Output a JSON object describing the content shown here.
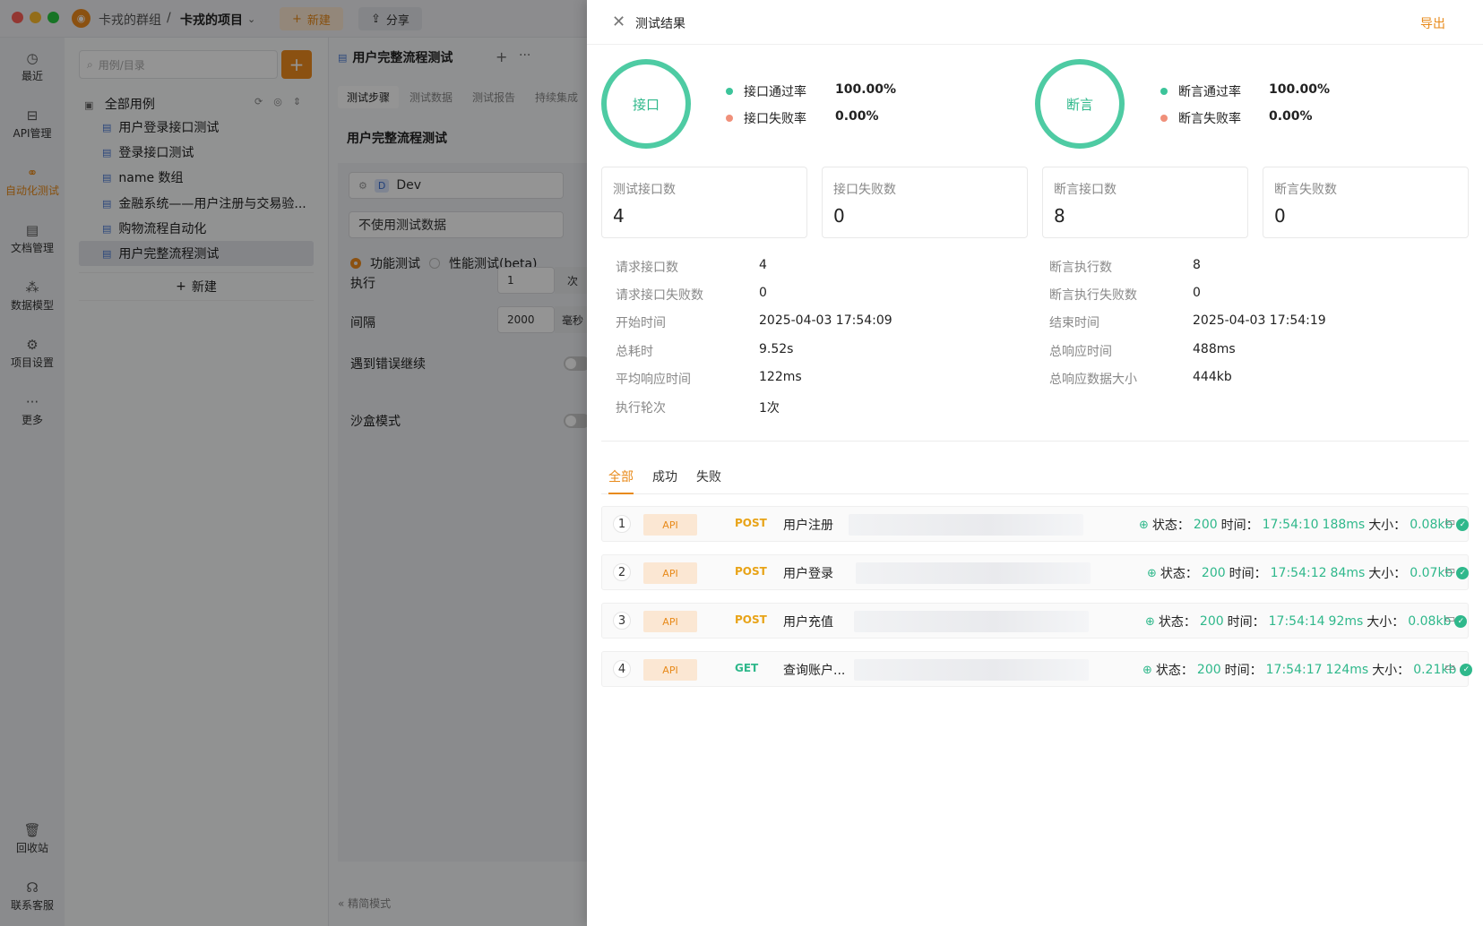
{
  "titlebar": {
    "group": "卡戎的群组",
    "separator": "/",
    "project": "卡戎的项目",
    "new_label": "新建",
    "share_label": "分享"
  },
  "leftnav": {
    "items": [
      {
        "label": "最近",
        "icon": "clock-icon"
      },
      {
        "label": "API管理",
        "icon": "api-icon"
      },
      {
        "label": "自动化测试",
        "icon": "automation-icon"
      },
      {
        "label": "文档管理",
        "icon": "document-icon"
      },
      {
        "label": "数据模型",
        "icon": "data-model-icon"
      },
      {
        "label": "项目设置",
        "icon": "settings-icon"
      },
      {
        "label": "更多",
        "icon": "more-icon"
      },
      {
        "label": "回收站",
        "icon": "trash-icon"
      },
      {
        "label": "联系客服",
        "icon": "headset-icon"
      }
    ]
  },
  "tree": {
    "search_placeholder": "用例/目录",
    "root": "全部用例",
    "items": [
      "用户登录接口测试",
      "登录接口测试",
      "name 数组",
      "金融系统——用户注册与交易验...",
      "购物流程自动化",
      "用户完整流程测试"
    ],
    "new_label": "新建"
  },
  "mid": {
    "tab": "用户完整流程测试",
    "subtabs": [
      "测试步骤",
      "测试数据",
      "测试报告",
      "持续集成"
    ],
    "title": "用户完整流程测试",
    "env": "Dev",
    "env_badge": "D",
    "data_select": "不使用测试数据",
    "radio_functional": "功能测试",
    "radio_perf": "性能测试(beta)",
    "exec_label": "执行",
    "exec_value": "1",
    "exec_unit": "次",
    "interval_label": "间隔",
    "interval_value": "2000",
    "interval_unit": "毫秒",
    "continue_label": "遇到错误继续",
    "sandbox_label": "沙盒模式",
    "simple_mode": "精简模式"
  },
  "drawer": {
    "title": "测试结果",
    "export": "导出",
    "ring_api": "接口",
    "ring_assert": "断言",
    "api_pass_label": "接口通过率",
    "api_pass_value": "100.00%",
    "api_fail_label": "接口失败率",
    "api_fail_value": "0.00%",
    "assert_pass_label": "断言通过率",
    "assert_pass_value": "100.00%",
    "assert_fail_label": "断言失败率",
    "assert_fail_value": "0.00%",
    "pass_color": "#3cc49a",
    "fail_color": "#f0907a",
    "cards": [
      {
        "label": "测试接口数",
        "value": "4"
      },
      {
        "label": "接口失败数",
        "value": "0"
      },
      {
        "label": "断言接口数",
        "value": "8"
      },
      {
        "label": "断言失败数",
        "value": "0"
      }
    ],
    "stats_left": [
      {
        "label": "请求接口数",
        "value": "4"
      },
      {
        "label": "请求接口失败数",
        "value": "0"
      },
      {
        "label": "开始时间",
        "value": "2025-04-03 17:54:09"
      },
      {
        "label": "总耗时",
        "value": "9.52s"
      },
      {
        "label": "平均响应时间",
        "value": "122ms"
      },
      {
        "label": "执行轮次",
        "value": "1次"
      }
    ],
    "stats_right": [
      {
        "label": "断言执行数",
        "value": "8"
      },
      {
        "label": "断言执行失败数",
        "value": "0"
      },
      {
        "label": "结束时间",
        "value": "2025-04-03 17:54:19"
      },
      {
        "label": "总响应时间",
        "value": "488ms"
      },
      {
        "label": "总响应数据大小",
        "value": "444kb"
      }
    ],
    "tabs": [
      "全部",
      "成功",
      "失败"
    ],
    "rows": [
      {
        "idx": "1",
        "tag": "API",
        "method": "POST",
        "name": "用户注册",
        "status_label": "状态：",
        "status": "200",
        "time_label": "时间：",
        "time": "17:54:10",
        "duration": "188ms",
        "size_label": "大小：",
        "size": "0.08kb"
      },
      {
        "idx": "2",
        "tag": "API",
        "method": "POST",
        "name": "用户登录",
        "status_label": "状态：",
        "status": "200",
        "time_label": "时间：",
        "time": "17:54:12",
        "duration": "84ms",
        "size_label": "大小：",
        "size": "0.07kb"
      },
      {
        "idx": "3",
        "tag": "API",
        "method": "POST",
        "name": "用户充值",
        "status_label": "状态：",
        "status": "200",
        "time_label": "时间：",
        "time": "17:54:14",
        "duration": "92ms",
        "size_label": "大小：",
        "size": "0.08kb"
      },
      {
        "idx": "4",
        "tag": "API",
        "method": "GET",
        "name": "查询账户...",
        "status_label": "状态：",
        "status": "200",
        "time_label": "时间：",
        "time": "17:54:17",
        "duration": "124ms",
        "size_label": "大小：",
        "size": "0.21kb"
      }
    ]
  }
}
